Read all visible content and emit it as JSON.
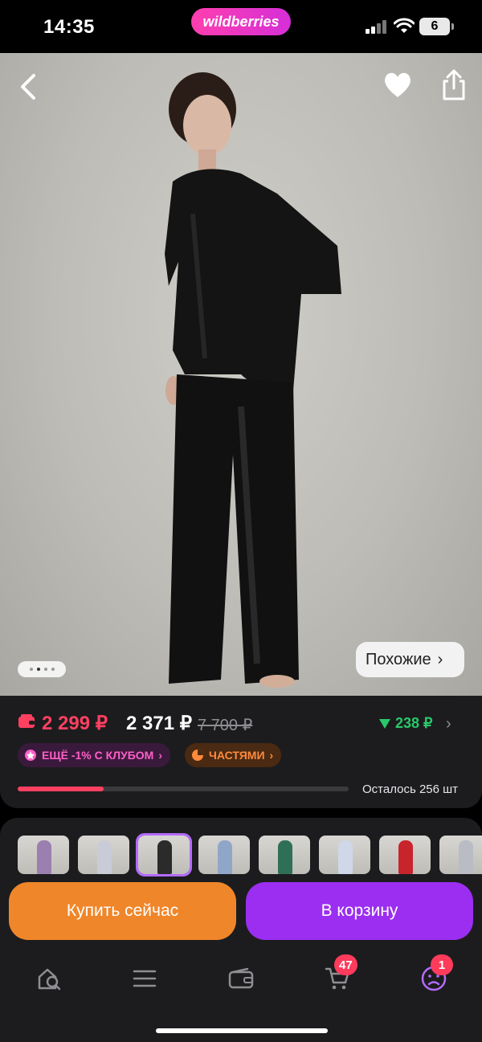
{
  "status_bar": {
    "time": "14:35",
    "brand": "wildberries",
    "battery": "6"
  },
  "product_photo": {
    "gallery_pages": 4,
    "gallery_active_index": 1,
    "similar_label": "Похожие"
  },
  "price": {
    "wallet_price": "2 299 ₽",
    "price": "2 371 ₽",
    "old_price": "7 700 ₽",
    "price_drop": "238 ₽",
    "club_badge": "ЕЩЁ -1% С КЛУБОМ",
    "installments_badge": "ЧАСТЯМИ",
    "stock_progress": 0.26,
    "stock_label": "Осталось 256 шт"
  },
  "thumbnails": [
    {
      "name": "thumb-1",
      "color": "#9a7fb0"
    },
    {
      "name": "thumb-2",
      "color": "#c9ccd6"
    },
    {
      "name": "thumb-3",
      "color": "#2b2b2b"
    },
    {
      "name": "thumb-4",
      "color": "#8fa6c8"
    },
    {
      "name": "thumb-5",
      "color": "#2f6f58"
    },
    {
      "name": "thumb-6",
      "color": "#cfd7e8"
    },
    {
      "name": "thumb-7",
      "color": "#c8242c"
    },
    {
      "name": "thumb-8",
      "color": "#b9bcc4"
    }
  ],
  "actions": {
    "buy_now": "Купить сейчас",
    "add_to_cart": "В корзину"
  },
  "tabbar": {
    "items": [
      "home-search-icon",
      "catalog-icon",
      "wallet-icon",
      "cart-icon",
      "profile-icon"
    ],
    "cart_badge": "47",
    "profile_badge": "1"
  },
  "colors": {
    "accent_purple": "#9b2ef0",
    "accent_orange": "#f0862a",
    "price_red": "#ff4061",
    "drop_green": "#29c86a"
  }
}
